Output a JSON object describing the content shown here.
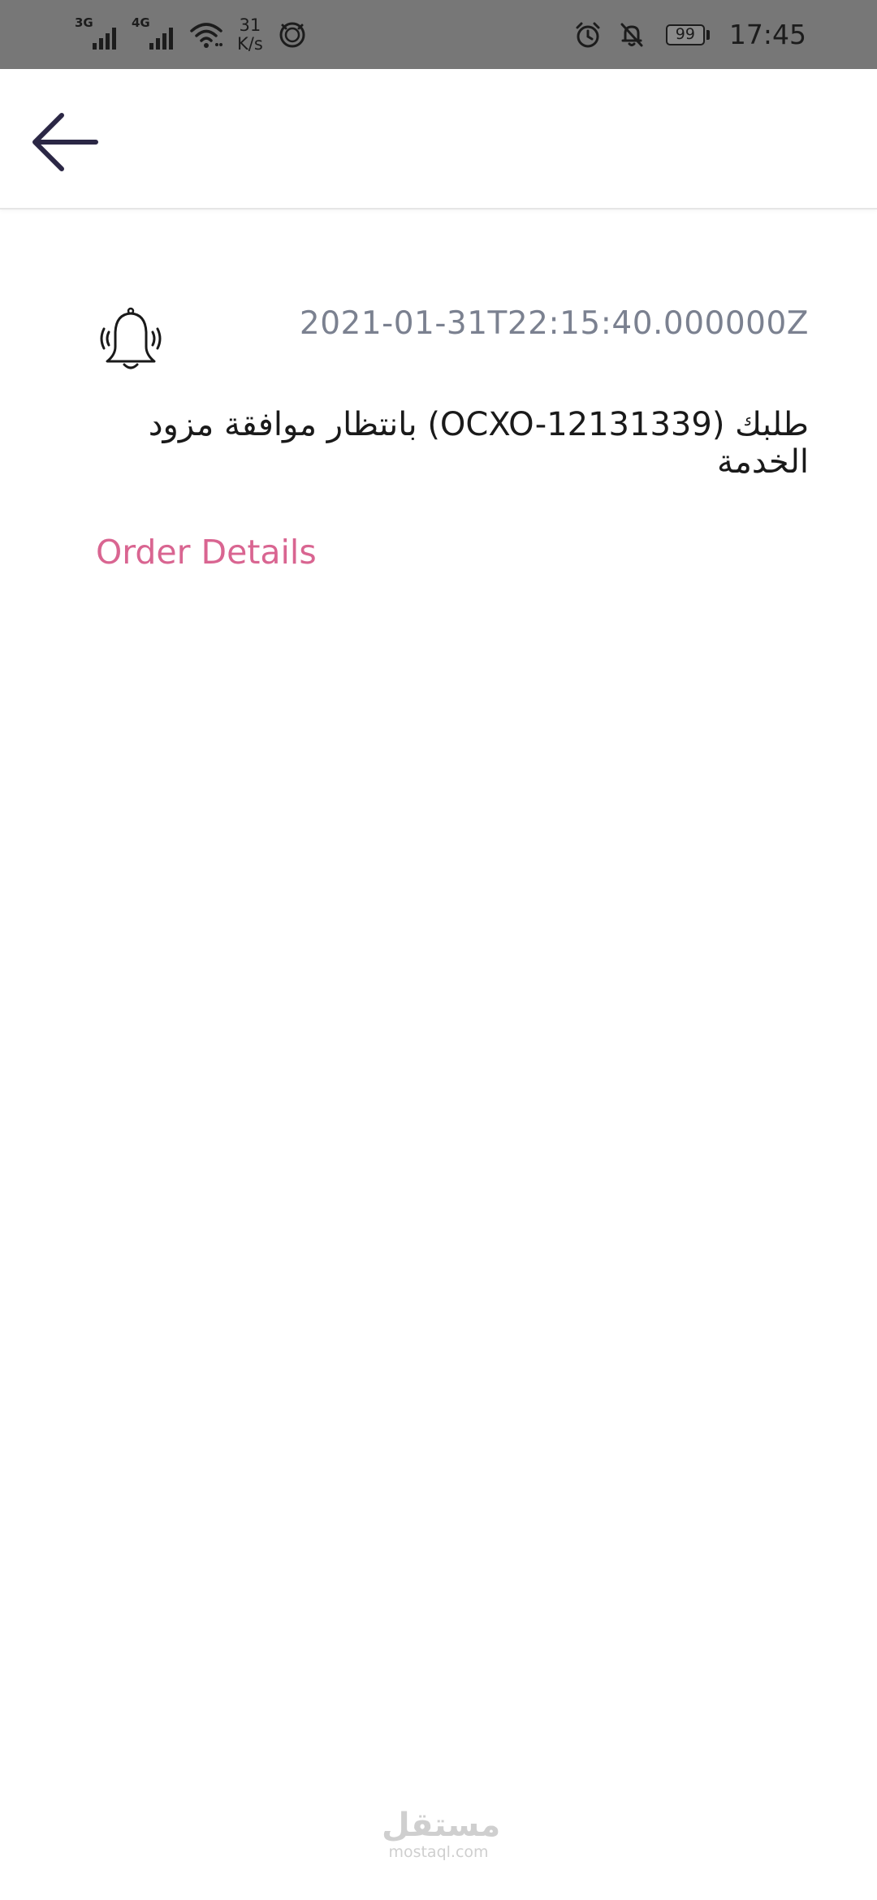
{
  "status_bar": {
    "network1": "3G",
    "network2": "4G",
    "speed_value": "31",
    "speed_unit": "K/s",
    "battery": "99",
    "time": "17:45"
  },
  "notification": {
    "timestamp": "2021-01-31T22:15:40.000000Z",
    "message": "طلبك (OCXO-12131339) بانتظار موافقة مزود الخدمة",
    "link_label": "Order Details"
  },
  "watermark": {
    "arabic": "مستقل",
    "latin": "mostaql.com"
  },
  "colors": {
    "status_bar_bg": "#777777",
    "timestamp": "#7b8190",
    "link": "#d96591",
    "back_arrow": "#2b2745"
  }
}
